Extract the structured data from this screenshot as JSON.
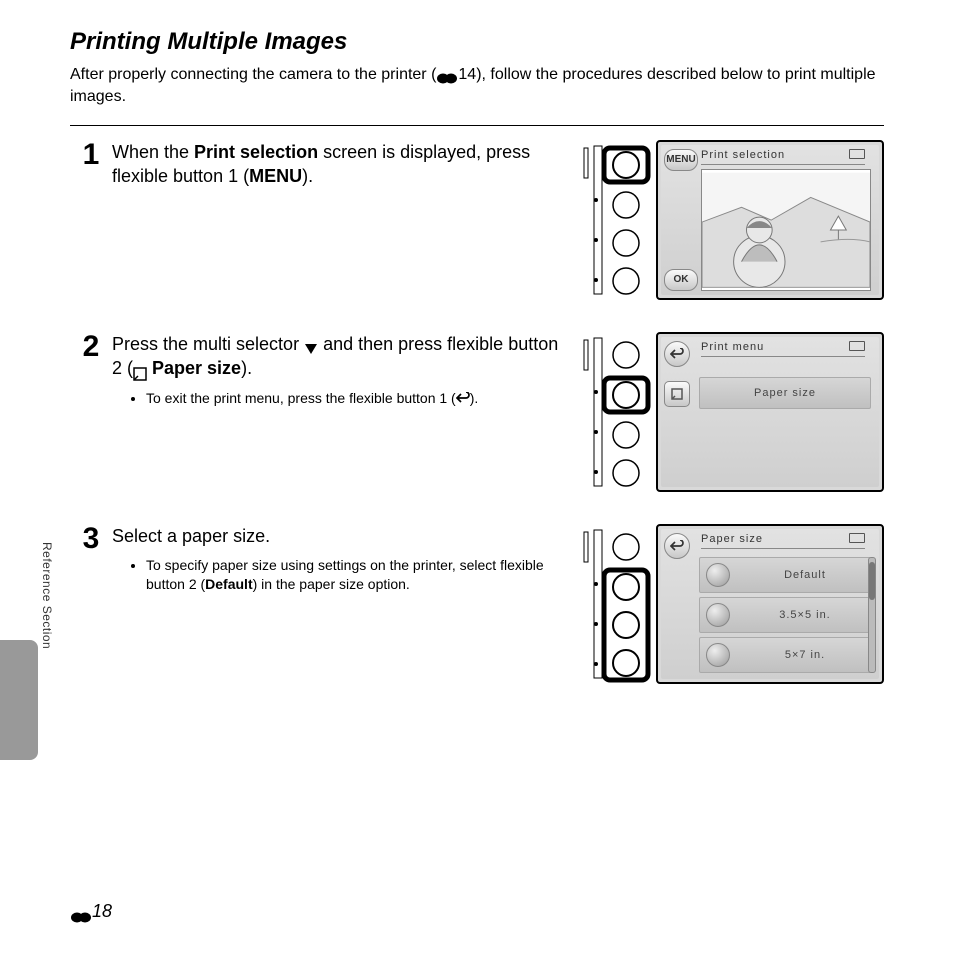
{
  "title": "Printing Multiple Images",
  "intro_a": "After properly connecting the camera to the printer (",
  "intro_ref": "14",
  "intro_b": "), follow the procedures described below to print multiple images.",
  "side_label": "Reference Section",
  "page_num": "18",
  "steps": [
    {
      "num": "1",
      "text_a": "When the ",
      "bold_a": "Print selection",
      "text_b": " screen is displayed, press flexible button 1 (",
      "bold_b": "MENU",
      "text_c": ").",
      "screen": {
        "title": "Print selection",
        "soft_top": "MENU",
        "soft_bot": "OK"
      }
    },
    {
      "num": "2",
      "text_a": "Press the multi selector ",
      "text_b": " and then press flexible button 2 (",
      "bold_a": " Paper size",
      "text_c": ").",
      "bullet_a": "To exit the print menu, press the flexible button 1 (",
      "bullet_b": ").",
      "screen": {
        "title": "Print menu",
        "opt1": "Paper size"
      }
    },
    {
      "num": "3",
      "text_a": "Select a paper size.",
      "bullet_a": "To specify paper size using settings on the printer, select flexible button 2 (",
      "bullet_bold": "Default",
      "bullet_b": ") in the paper size option.",
      "screen": {
        "title": "Paper size",
        "opts": [
          "Default",
          "3.5×5 in.",
          "5×7 in."
        ]
      }
    }
  ]
}
